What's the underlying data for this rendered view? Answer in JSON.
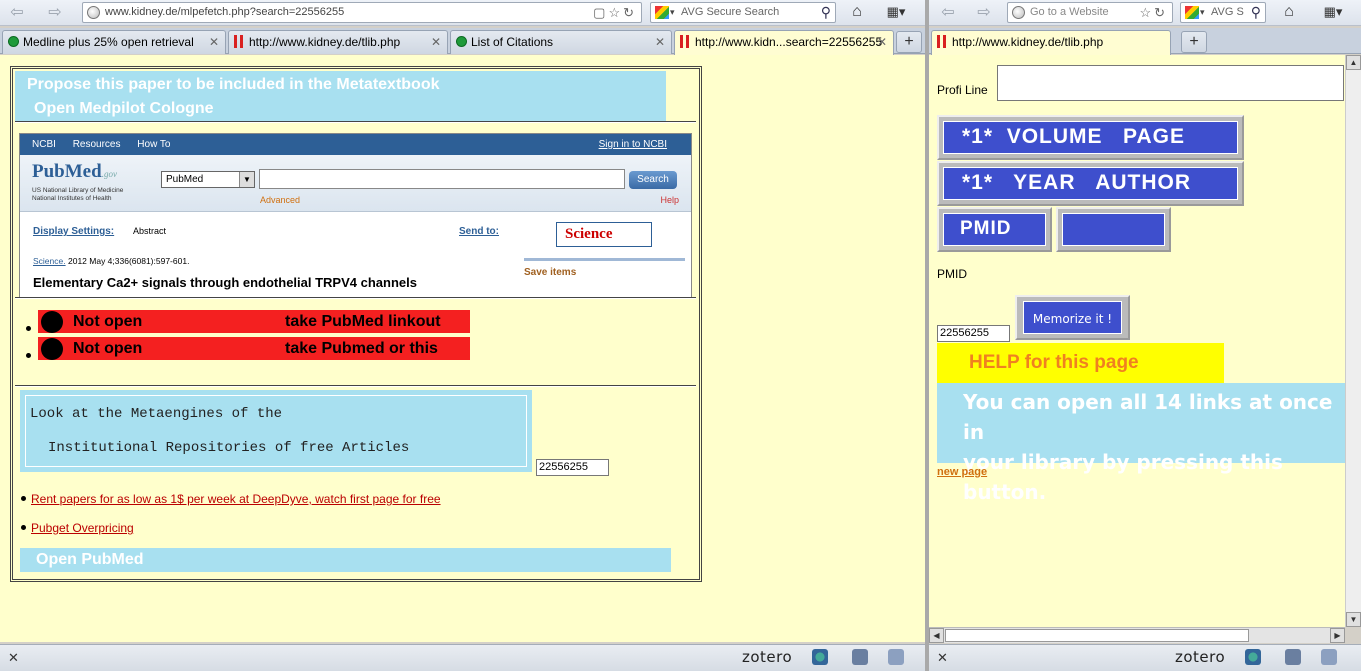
{
  "left": {
    "url": "www.kidney.de/mlpefetch.php?search=22556255",
    "search_placeholder": "AVG Secure Search",
    "tabs": [
      {
        "label": "Medline plus 25% open retrieval"
      },
      {
        "label": "http://www.kidney.de/tlib.php"
      },
      {
        "label": "List of Citations"
      },
      {
        "label": "http://www.kidn...search=22556255"
      }
    ],
    "page": {
      "propose_line1": "Propose this paper to be included in the Metatextbook",
      "propose_line2": "Open Medpilot Cologne",
      "ncbi": {
        "brand": "NCBI",
        "resources": "Resources",
        "howto": "How To",
        "signin": "Sign in to NCBI",
        "logo": "PubMed",
        "logo_suffix": ".gov",
        "nlm_line1": "US National Library of Medicine",
        "nlm_line2": "National Institutes of Health",
        "db": "PubMed",
        "search_btn": "Search",
        "advanced": "Advanced",
        "help": "Help",
        "display_settings": "Display Settings:",
        "abstract": "Abstract",
        "send_to": "Send to:",
        "science": "Science",
        "journal_name": "Science.",
        "journal_info": "2012 May 4;336(6081):597-601.",
        "title": "Elementary Ca2+ signals through endothelial TRPV4 channels",
        "save_items": "Save items"
      },
      "red1_left": "Not open",
      "red1_right": "take PubMed linkout",
      "red2_left": "Not open",
      "red2_right": "take Pubmed or this",
      "meta_line1": "Look at the Metaengines of the",
      "meta_line2": "Institutional Repositories of free Articles",
      "pmid_value": "22556255",
      "link1": "Rent papers for as low as 1$ per week at DeepDyve, watch first page for free",
      "link2": "Pubget Overpricing",
      "open_pubmed": "Open PubMed"
    },
    "status": {
      "zotero": "zotero"
    }
  },
  "right": {
    "url_placeholder": "Go to a Website",
    "search_placeholder": "AVG S",
    "tab": "http://www.kidney.de/tlib.php",
    "page": {
      "profi_label": "Profi Line",
      "btn_volume": "*1*  VOLUME   PAGE",
      "btn_year": "*1*   YEAR   AUTHOR",
      "btn_pmid": "PMID",
      "pmid_label": "PMID",
      "memorize": "Memorize it !",
      "pmid_value": "22556255",
      "help": "HELP for this page",
      "info_line1": "You can open all 14 links at once in",
      "info_line2": "your library by pressing this button.",
      "new_page": "new page"
    },
    "status": {
      "zotero": "zotero"
    }
  }
}
